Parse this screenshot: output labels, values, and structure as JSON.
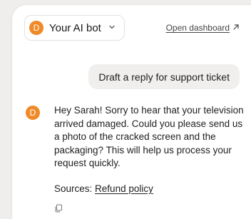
{
  "header": {
    "bot_initial": "D",
    "bot_name": "Your AI bot",
    "dashboard_link": "Open dashboard"
  },
  "messages": {
    "user": "Draft a reply for support ticket",
    "bot_initial": "D",
    "bot_reply": "Hey Sarah! Sorry to hear that your television arrived damaged. Could you please send us a photo of the cracked screen and the packaging? This will help us process your request quickly.",
    "sources_label": "Sources:",
    "sources_link": "Refund policy"
  },
  "icons": {
    "chevron": "chevron-down-icon",
    "external": "arrow-up-right-icon",
    "copy": "copy-icon"
  },
  "colors": {
    "accent": "#f08a28",
    "background": "#efeeec",
    "bubble": "#f0efed"
  }
}
